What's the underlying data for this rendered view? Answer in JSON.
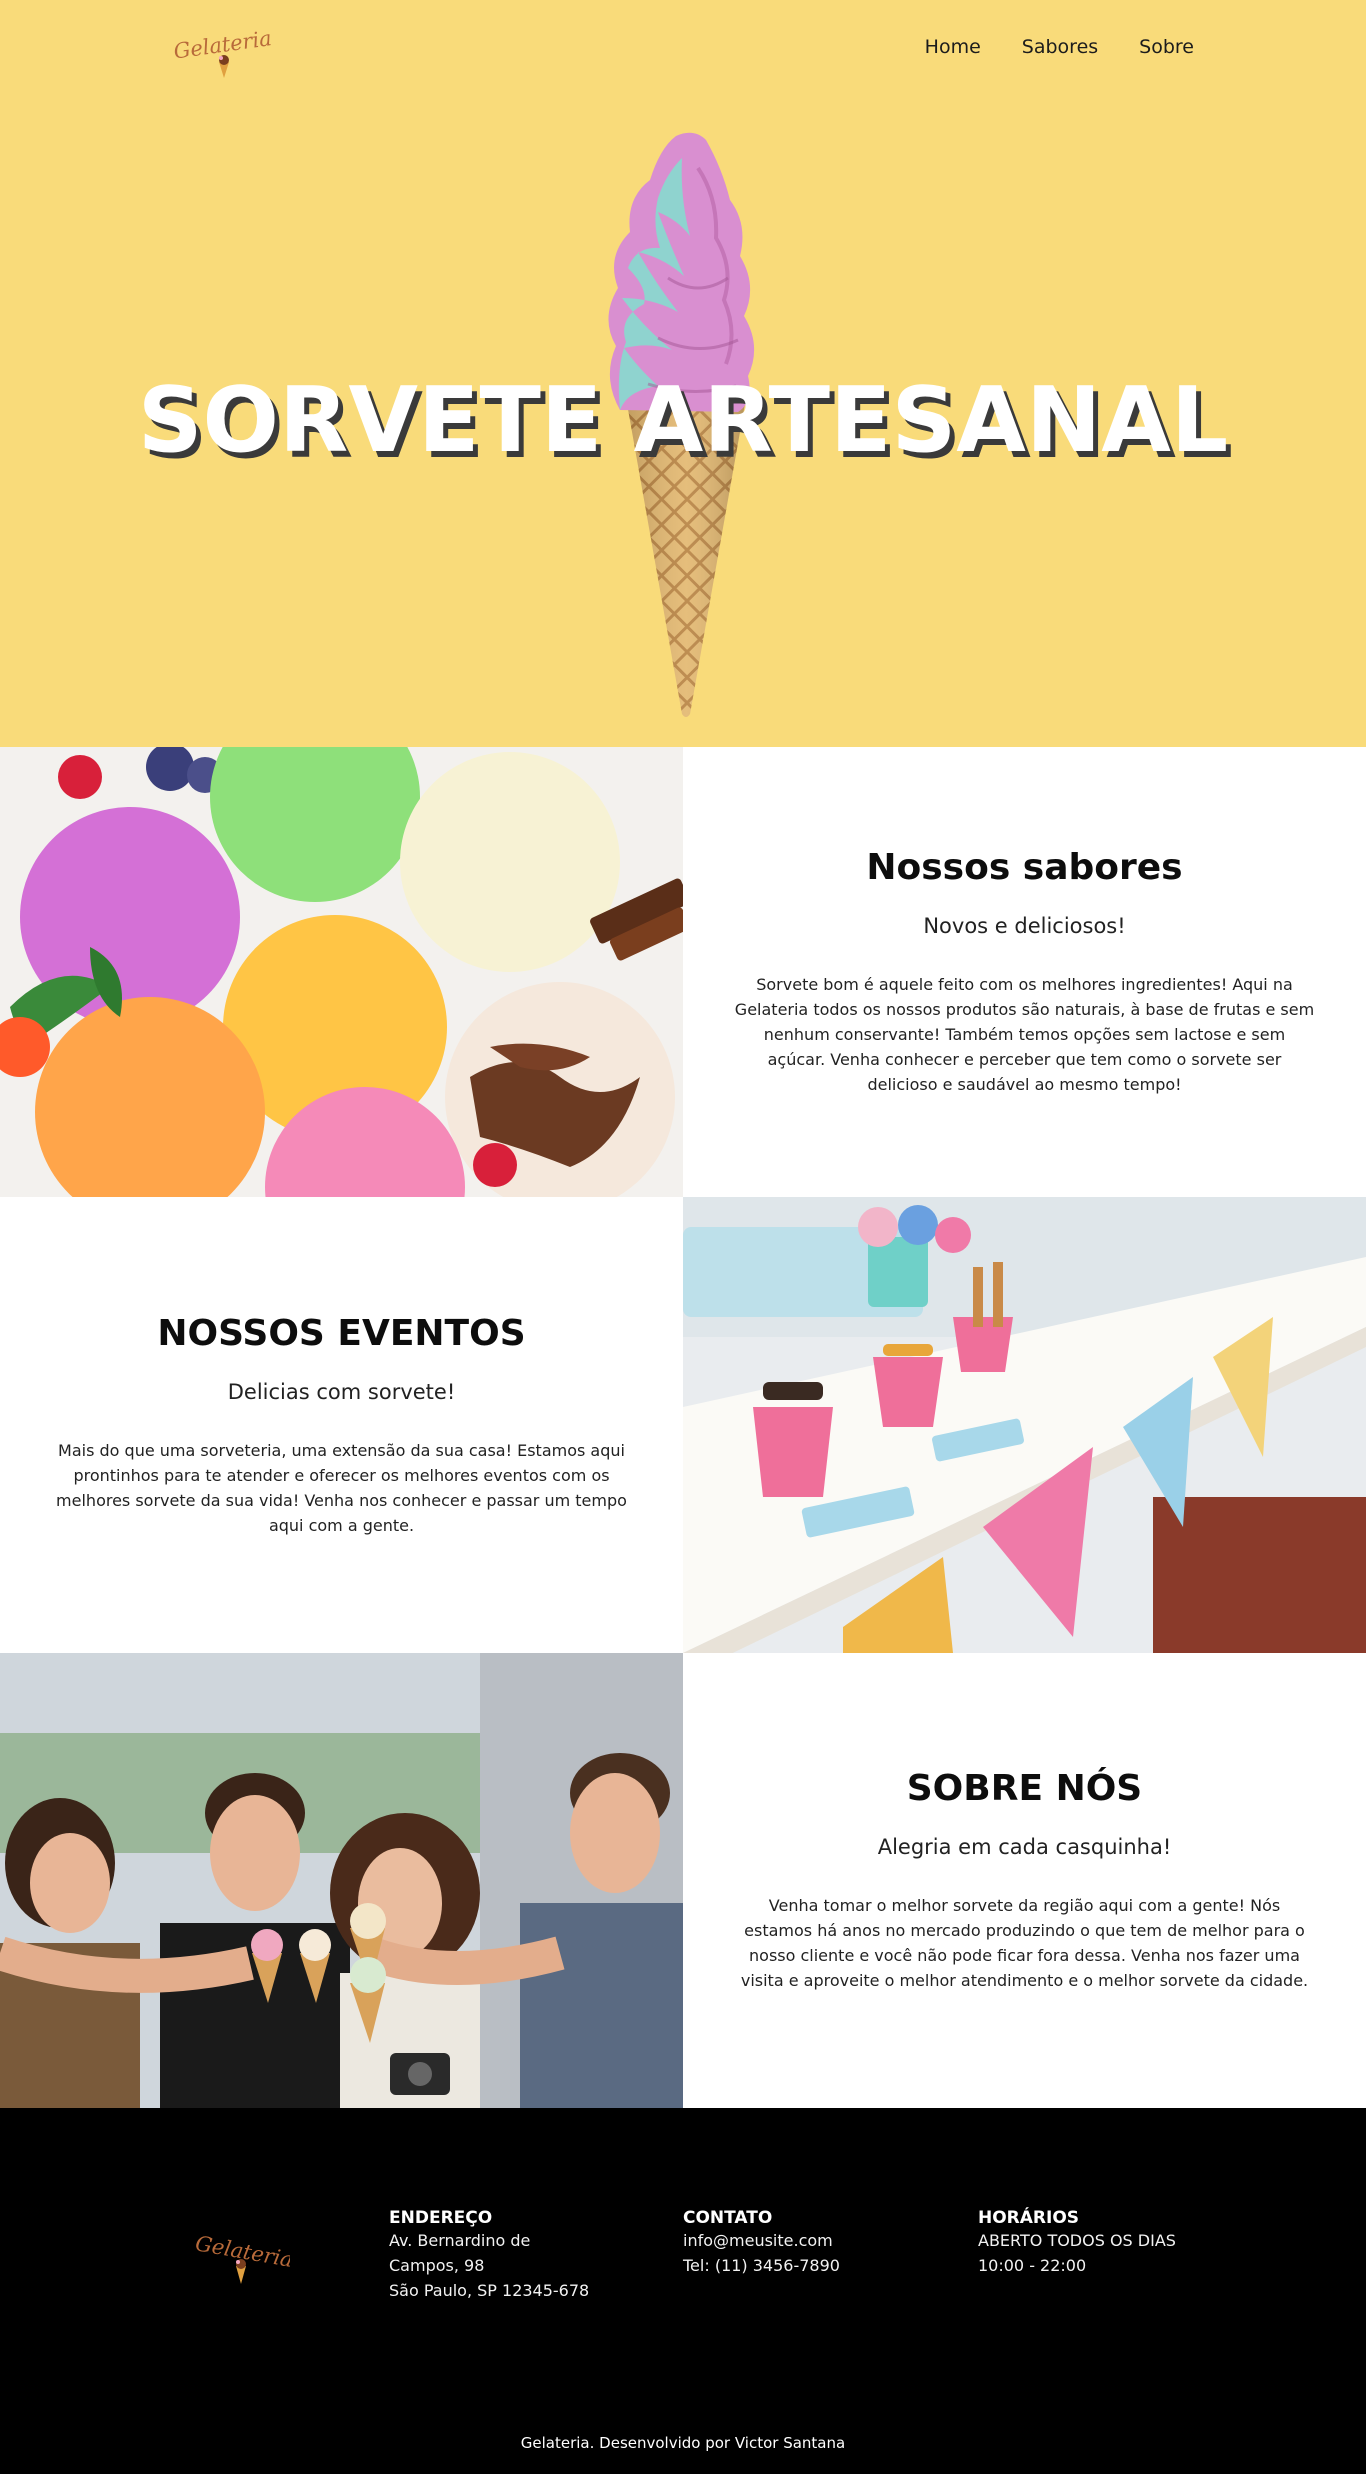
{
  "header": {
    "logo_text": "Gelateria",
    "nav": [
      {
        "label": "Home"
      },
      {
        "label": "Sabores"
      },
      {
        "label": "Sobre"
      }
    ]
  },
  "hero": {
    "title": "SORVETE ARTESANAL"
  },
  "sections": {
    "flavors": {
      "title": "Nossos sabores",
      "subtitle": "Novos e deliciosos!",
      "body": "Sorvete bom é aquele feito com os melhores ingredientes! Aqui na Gelateria todos os nossos produtos são naturais, à base de frutas e sem nenhum conservante! Também temos opções sem lactose e sem açúcar. Venha conhecer e perceber que tem como o sorvete ser delicioso e saudável ao mesmo tempo!"
    },
    "events": {
      "title": "NOSSOS EVENTOS",
      "subtitle": "Delicias com sorvete!",
      "body": "Mais do que uma sorveteria, uma extensão da sua casa! Estamos aqui prontinhos para te atender e oferecer os melhores eventos com os melhores sorvete da sua vida! Venha nos conhecer e passar um tempo aqui com a gente."
    },
    "about": {
      "title": "SOBRE NÓS",
      "subtitle": "Alegria em cada casquinha!",
      "body": "Venha tomar o melhor sorvete da região aqui com a gente! Nós estamos há anos no mercado produzindo o que tem de melhor para o nosso cliente e você não pode ficar fora dessa. Venha nos fazer uma visita e aproveite o melhor atendimento e o melhor sorvete da cidade."
    }
  },
  "footer": {
    "logo_text": "Gelateria",
    "address": {
      "heading": "ENDEREÇO",
      "lines": [
        "Av. Bernardino de",
        "Campos, 98",
        "São Paulo, SP 12345-678"
      ]
    },
    "contact": {
      "heading": "CONTATO",
      "lines": [
        "info@meusite.com",
        "Tel: (11) 3456-7890"
      ]
    },
    "hours": {
      "heading": "HORÁRIOS",
      "lines": [
        "ABERTO TODOS OS DIAS",
        "10:00 - 22:00"
      ]
    },
    "credit": "Gelateria. Desenvolvido por Victor Santana"
  },
  "colors": {
    "hero_bg": "#f9db7a",
    "footer_bg": "#000000",
    "logo_brown": "#b86a3a"
  }
}
